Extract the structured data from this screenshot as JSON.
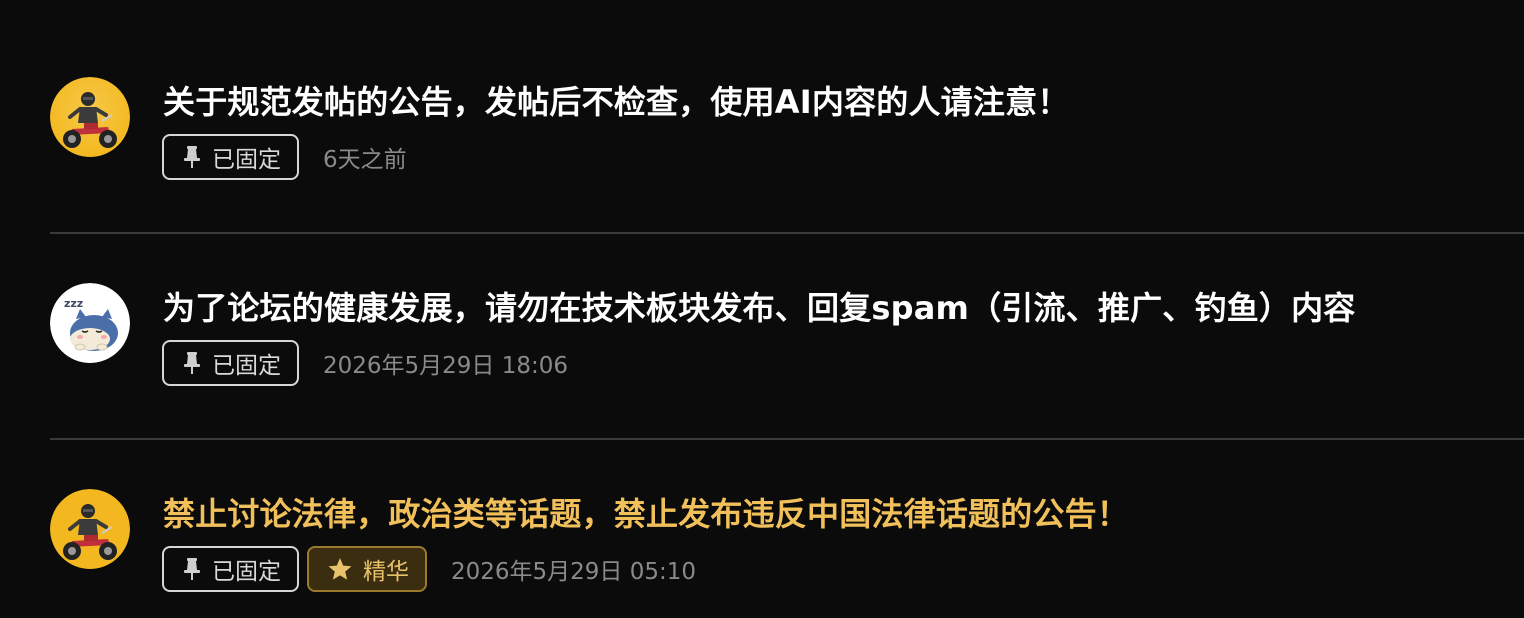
{
  "posts": [
    {
      "title": "关于规范发帖的公告，发帖后不检查，使用AI内容的人请注意！",
      "pinned_label": "已固定",
      "time": "6天之前",
      "featured": false,
      "avatar_icon": "motorcycle-rider-avatar"
    },
    {
      "title": "为了论坛的健康发展，请勿在技术板块发布、回复spam（引流、推广、钓鱼）内容",
      "pinned_label": "已固定",
      "time": "2026年5月29日 18:06",
      "featured": false,
      "avatar_icon": "sleeping-cat-avatar"
    },
    {
      "title": "禁止讨论法律，政治类等话题，禁止发布违反中国法律话题的公告！",
      "pinned_label": "已固定",
      "featured_label": "精华",
      "time": "2026年5月29日 05:10",
      "featured": true,
      "avatar_icon": "motorcycle-rider-avatar"
    }
  ],
  "colors": {
    "background": "#0b0b0b",
    "title": "#ffffff",
    "featured_title": "#f1c05a",
    "badge_border": "#d6d6d6",
    "featured_badge_bg": "#3a2d10",
    "featured_badge_text": "#e8c26a",
    "time": "#8a8a8a",
    "divider": "#3a3a3a"
  }
}
